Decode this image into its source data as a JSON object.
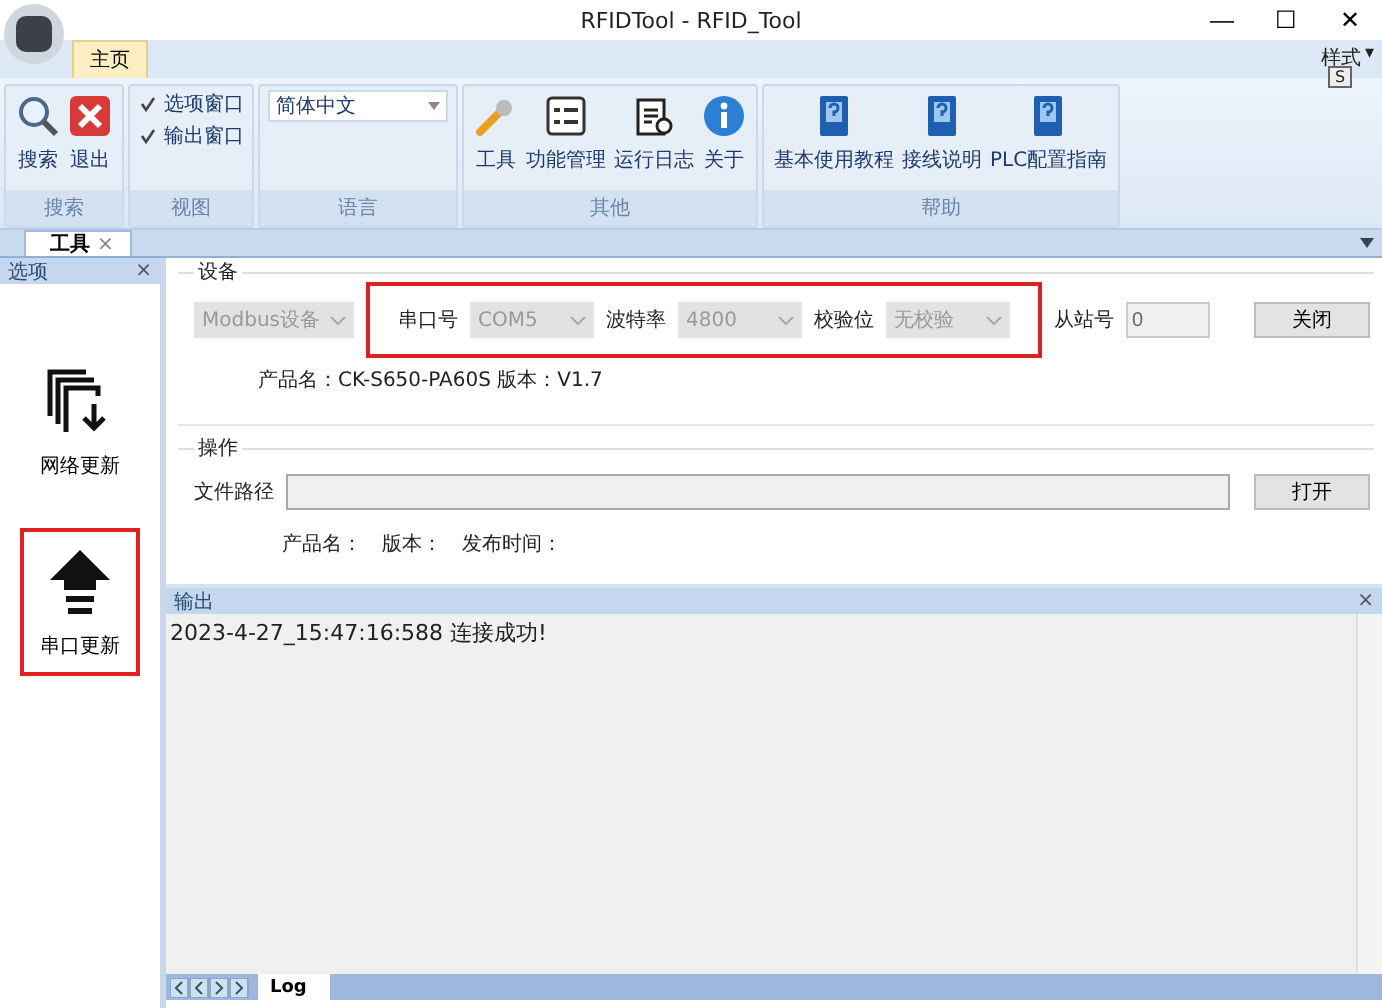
{
  "window": {
    "title": "RFIDTool - RFID_Tool",
    "controls": [
      "—",
      "☐",
      "✕"
    ]
  },
  "ribbon_tabs": [
    {
      "label": "主页",
      "selected": true
    }
  ],
  "style_menu": {
    "label": "样式",
    "key_tip": "S",
    "caret": "▾"
  },
  "ribbon_groups": [
    {
      "label": "搜索",
      "items": [
        {
          "kind": "button",
          "label": "搜索"
        },
        {
          "kind": "button",
          "label": "退出"
        }
      ]
    },
    {
      "label": "视图",
      "items": [
        {
          "kind": "checkbox",
          "label": "选项窗口",
          "checked": true
        },
        {
          "kind": "checkbox",
          "label": "输出窗口",
          "checked": true
        }
      ]
    },
    {
      "label": "语言",
      "items": [
        {
          "kind": "dropdown",
          "value": "简体中文"
        }
      ]
    },
    {
      "label": "其他",
      "items": [
        {
          "kind": "button",
          "label": "工具"
        },
        {
          "kind": "button",
          "label": "功能管理"
        },
        {
          "kind": "button",
          "label": "运行日志"
        },
        {
          "kind": "button",
          "label": "关于"
        }
      ]
    },
    {
      "label": "帮助",
      "items": [
        {
          "kind": "button",
          "label": "基本使用教程"
        },
        {
          "kind": "button",
          "label": "接线说明"
        },
        {
          "kind": "button",
          "label": "PLC配置指南"
        }
      ]
    }
  ],
  "document_tabs": [
    {
      "label": "工具",
      "selected": true,
      "close": "×"
    }
  ],
  "options_panel": {
    "title": "选项",
    "close": "×",
    "items": [
      {
        "label": "网络更新",
        "highlighted": false
      },
      {
        "label": "串口更新",
        "highlighted": true
      }
    ]
  },
  "device_group": {
    "title": "设备",
    "device_type": "Modbus设备",
    "port_settings_highlighted": true,
    "port_fields": [
      {
        "label": "串口号",
        "value": "COM5"
      },
      {
        "label": "波特率",
        "value": "4800"
      },
      {
        "label": "校验位",
        "value": "无校验"
      }
    ],
    "station": {
      "label": "从站号",
      "value": "0"
    },
    "button": "关闭",
    "product_info": "产品名：CK-S650-PA60S  版本：V1.7"
  },
  "operation_group": {
    "title": "操作",
    "file_path_label": "文件路径",
    "button": "打开",
    "info": [
      "产品名：",
      "版本：",
      "发布时间："
    ]
  },
  "output_panel": {
    "title": "输出",
    "close": "×",
    "lines": [
      "2023-4-27_15:47:16:588   连接成功!"
    ],
    "tabs": [
      {
        "label": "Log",
        "selected": true
      }
    ]
  }
}
